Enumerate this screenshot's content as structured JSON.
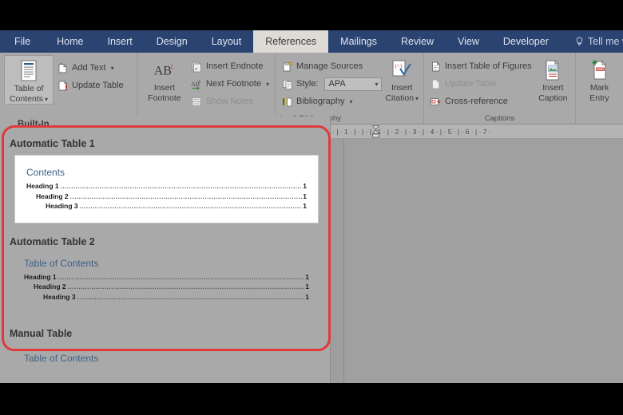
{
  "window": {
    "app": "Microsoft Word"
  },
  "ribbon": {
    "tabs": [
      {
        "label": "File",
        "active": false
      },
      {
        "label": "Home",
        "active": false
      },
      {
        "label": "Insert",
        "active": false
      },
      {
        "label": "Design",
        "active": false
      },
      {
        "label": "Layout",
        "active": false
      },
      {
        "label": "References",
        "active": true
      },
      {
        "label": "Mailings",
        "active": false
      },
      {
        "label": "Review",
        "active": false
      },
      {
        "label": "View",
        "active": false
      },
      {
        "label": "Developer",
        "active": false
      }
    ],
    "tell_me": "Tell me what you",
    "groups": [
      {
        "name": "table-of-contents",
        "label": "",
        "big": {
          "line1": "Table of",
          "line2": "Contents",
          "caret": "▾",
          "icon": "table-of-contents-icon"
        },
        "items": [
          {
            "label": "Add Text",
            "caret": "▾",
            "icon": "add-text-icon",
            "dim": false
          },
          {
            "label": "Update Table",
            "caret": "",
            "icon": "update-table-icon",
            "dim": false
          }
        ]
      },
      {
        "name": "footnotes",
        "label": "",
        "big": {
          "line1": "Insert",
          "line2": "Footnote",
          "caret": "",
          "icon": "insert-footnote-icon",
          "glyph": "AB",
          "sup": "1"
        },
        "items": [
          {
            "label": "Insert Endnote",
            "caret": "",
            "icon": "insert-endnote-icon",
            "dim": false
          },
          {
            "label": "Next Footnote",
            "caret": "▾",
            "icon": "next-footnote-icon",
            "dim": false
          },
          {
            "label": "Show Notes",
            "caret": "",
            "icon": "show-notes-icon",
            "dim": true
          }
        ]
      },
      {
        "name": "citations-bibliography",
        "label": "ins & Bibliography",
        "big": {
          "line1": "Insert",
          "line2": "Citation",
          "caret": "▾",
          "icon": "insert-citation-icon"
        },
        "items": [
          {
            "label": "Manage Sources",
            "caret": "",
            "icon": "manage-sources-icon",
            "dim": false
          },
          {
            "label": "Style:",
            "caret": "",
            "icon": "style-icon",
            "dim": false,
            "select": {
              "value": "APA",
              "caret": "▾"
            }
          },
          {
            "label": "Bibliography",
            "caret": "▾",
            "icon": "bibliography-icon",
            "dim": false
          }
        ]
      },
      {
        "name": "captions",
        "label": "Captions",
        "big": {
          "line1": "Insert",
          "line2": "Caption",
          "caret": "",
          "icon": "insert-caption-icon"
        },
        "items": [
          {
            "label": "Insert Table of Figures",
            "caret": "",
            "icon": "insert-table-of-figures-icon",
            "dim": false
          },
          {
            "label": "Update Table",
            "caret": "",
            "icon": "update-table-icon",
            "dim": true
          },
          {
            "label": "Cross-reference",
            "caret": "",
            "icon": "cross-reference-icon",
            "dim": false
          }
        ]
      },
      {
        "name": "index",
        "label": "",
        "big": {
          "line1": "Mark",
          "line2": "Entry",
          "caret": "",
          "icon": "mark-entry-icon"
        },
        "items": []
      }
    ]
  },
  "ruler": {
    "ticks": "·  |  ·  1  ·  |  ·  |  ·  |  ·  1  ·  |  ·  2  ·  |  ·  3  ·  |  ·  4  ·  |  ·  5  ·  |  ·  6  ·  |  ·  7  ·",
    "indent_marker": "indent-marker-icon"
  },
  "gallery": {
    "section_header": "Built-In",
    "entries": [
      {
        "title": "Automatic Table 1",
        "card": true,
        "toc_title": "Contents",
        "rows": [
          {
            "label": "Heading 1",
            "page": "1",
            "level": 1
          },
          {
            "label": "Heading 2",
            "page": "1",
            "level": 2
          },
          {
            "label": "Heading 3",
            "page": "1",
            "level": 3
          }
        ]
      },
      {
        "title": "Automatic Table 2",
        "card": false,
        "toc_title": "Table of Contents",
        "rows": [
          {
            "label": "Heading 1",
            "page": "1",
            "level": 1
          },
          {
            "label": "Heading 2",
            "page": "1",
            "level": 2
          },
          {
            "label": "Heading 3",
            "page": "1",
            "level": 3
          }
        ]
      },
      {
        "title": "Manual Table",
        "card": false,
        "toc_title": "Table of Contents",
        "rows": []
      }
    ]
  },
  "annotation": {
    "shape": "rounded-rectangle-highlight",
    "color": "#e03a3a"
  },
  "colors": {
    "ribbon_blue": "#2b4370",
    "active_tab": "#dedbd6",
    "panel_gray": "#a9a9a9",
    "toc_heading_blue": "#3f6287",
    "annotation_red": "#e03a3a"
  }
}
